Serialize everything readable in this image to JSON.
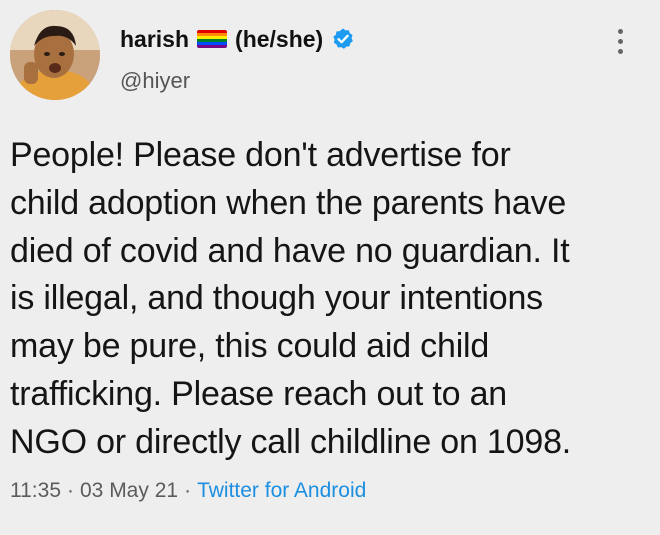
{
  "tweet": {
    "display_name": "harish",
    "pronouns": "(he/she)",
    "handle": "@hiyer",
    "body_lines": [
      "People! Please don't advertise for",
      "child adoption when the parents have",
      "died of covid and have no guardian. It",
      "is illegal, and though your intentions",
      "may be pure, this could aid  child",
      "trafficking.  Please reach out to an",
      "NGO or directly call childline on 1098."
    ],
    "time": "11:35",
    "date": "03 May 21",
    "separator": "·",
    "source_app": "Twitter for Android"
  },
  "icons": {
    "flag": "rainbow-flag-icon",
    "verified": "verified-badge-icon",
    "more": "more-vertical-icon"
  },
  "colors": {
    "background": "#eeeeee",
    "link": "#1d8fe0",
    "verified": "#1d9bf0",
    "flag": [
      "#e40303",
      "#ff8c00",
      "#ffed00",
      "#008026",
      "#004dff",
      "#750787"
    ]
  }
}
